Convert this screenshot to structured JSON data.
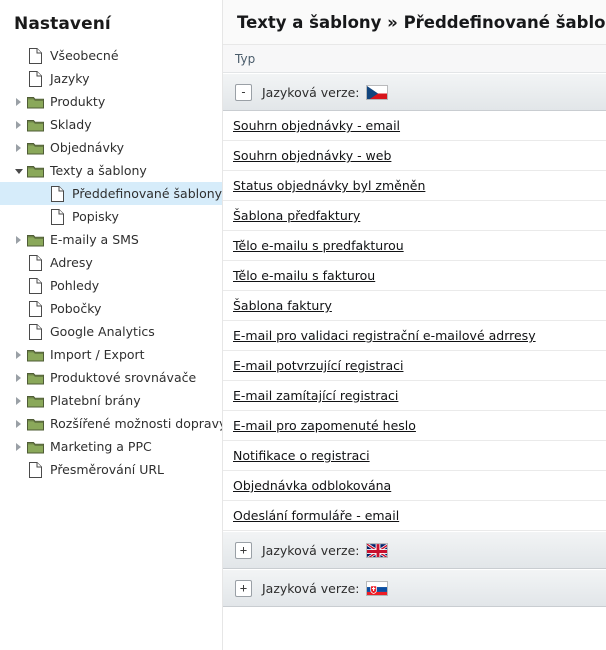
{
  "sidebar": {
    "title": "Nastavení",
    "items": [
      {
        "label": "Všeobecné",
        "icon": "file-icon",
        "type": "file",
        "twist": "none",
        "level": 1,
        "selected": false
      },
      {
        "label": "Jazyky",
        "icon": "file-icon",
        "type": "file",
        "twist": "none",
        "level": 1,
        "selected": false
      },
      {
        "label": "Produkty",
        "icon": "folder-icon",
        "type": "folder",
        "twist": "collapsed",
        "level": 1,
        "selected": false
      },
      {
        "label": "Sklady",
        "icon": "folder-icon",
        "type": "folder",
        "twist": "collapsed",
        "level": 1,
        "selected": false
      },
      {
        "label": "Objednávky",
        "icon": "folder-icon",
        "type": "folder",
        "twist": "collapsed",
        "level": 1,
        "selected": false
      },
      {
        "label": "Texty a šablony",
        "icon": "folder-icon",
        "type": "folder",
        "twist": "expanded",
        "level": 1,
        "selected": false
      },
      {
        "label": "Předdefinované šablony",
        "icon": "file-icon",
        "type": "file",
        "twist": "none",
        "level": 2,
        "selected": true
      },
      {
        "label": "Popisky",
        "icon": "file-icon",
        "type": "file",
        "twist": "none",
        "level": 2,
        "selected": false
      },
      {
        "label": "E-maily a SMS",
        "icon": "folder-icon",
        "type": "folder",
        "twist": "collapsed",
        "level": 1,
        "selected": false
      },
      {
        "label": "Adresy",
        "icon": "file-icon",
        "type": "file",
        "twist": "none",
        "level": 1,
        "selected": false
      },
      {
        "label": "Pohledy",
        "icon": "file-icon",
        "type": "file",
        "twist": "none",
        "level": 1,
        "selected": false
      },
      {
        "label": "Pobočky",
        "icon": "file-icon",
        "type": "file",
        "twist": "none",
        "level": 1,
        "selected": false
      },
      {
        "label": "Google Analytics",
        "icon": "file-icon",
        "type": "file",
        "twist": "none",
        "level": 1,
        "selected": false
      },
      {
        "label": "Import / Export",
        "icon": "folder-icon",
        "type": "folder",
        "twist": "collapsed",
        "level": 1,
        "selected": false
      },
      {
        "label": "Produktové srovnávače",
        "icon": "folder-icon",
        "type": "folder",
        "twist": "collapsed",
        "level": 1,
        "selected": false
      },
      {
        "label": "Platební brány",
        "icon": "folder-icon",
        "type": "folder",
        "twist": "collapsed",
        "level": 1,
        "selected": false
      },
      {
        "label": "Rozšířené možnosti dopravy",
        "icon": "folder-icon",
        "type": "folder",
        "twist": "collapsed",
        "level": 1,
        "selected": false
      },
      {
        "label": "Marketing a PPC",
        "icon": "folder-icon",
        "type": "folder",
        "twist": "collapsed",
        "level": 1,
        "selected": false
      },
      {
        "label": "Přesměrování URL",
        "icon": "file-icon",
        "type": "file",
        "twist": "none",
        "level": 1,
        "selected": false
      }
    ]
  },
  "main": {
    "title": "Texty a šablony » Předdefinované šablony",
    "column_header": "Typ",
    "groups": [
      {
        "toggle": "-",
        "state": "expanded",
        "label": "Jazyková verze:",
        "flag": "flag-cz",
        "rows": [
          {
            "label": "Souhrn objednávky - email"
          },
          {
            "label": "Souhrn objednávky - web"
          },
          {
            "label": "Status objednávky byl změněn"
          },
          {
            "label": "Šablona předfaktury"
          },
          {
            "label": "Tělo e-mailu s predfakturou"
          },
          {
            "label": "Tělo e-mailu s fakturou"
          },
          {
            "label": "Šablona faktury"
          },
          {
            "label": "E-mail pro validaci registrační e-mailové adrresy"
          },
          {
            "label": "E-mail potvrzující registraci"
          },
          {
            "label": "E-mail zamítající registraci"
          },
          {
            "label": "E-mail pro zapomenuté heslo"
          },
          {
            "label": "Notifikace o registraci"
          },
          {
            "label": "Objednávka odblokována"
          },
          {
            "label": "Odeslání formuláře - email"
          }
        ]
      },
      {
        "toggle": "+",
        "state": "collapsed",
        "label": "Jazyková verze:",
        "flag": "flag-gb",
        "rows": []
      },
      {
        "toggle": "+",
        "state": "collapsed",
        "label": "Jazyková verze:",
        "flag": "flag-sk",
        "rows": []
      }
    ]
  },
  "colors": {
    "selection": "#d6ecfa",
    "group_header_top": "#f2f4f5",
    "group_header_bottom": "#e2e6e9",
    "folder": "#8aa85a",
    "link_text": "#111214",
    "title_text": "#17181a"
  }
}
